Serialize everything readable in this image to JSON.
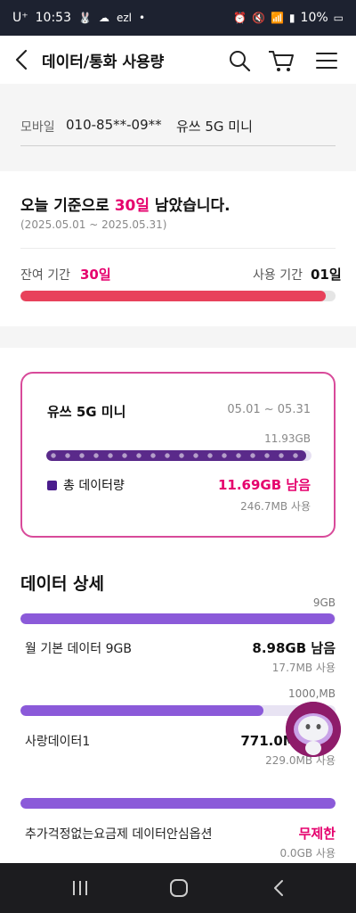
{
  "status_bar": {
    "carrier": "U⁺",
    "time": "10:53",
    "battery": "10%"
  },
  "app_bar": {
    "title": "데이터/통화 사용량",
    "icons": [
      "back-arrow-icon",
      "search-icon",
      "cart-icon",
      "menu-icon"
    ]
  },
  "line_info": {
    "label": "모바일",
    "number": "010-85**-09**",
    "plan": "유쓰 5G 미니"
  },
  "period_summary": {
    "headline_prefix": "오늘 기준으로 ",
    "headline_highlight": "30일",
    "headline_suffix": " 남았습니다.",
    "date_range": "(2025.05.01 ~ 2025.05.31)",
    "remaining_label": "잔여 기간",
    "remaining_value": "30일",
    "used_label": "사용 기간",
    "used_value": "01일",
    "progress_fraction": 0.968
  },
  "plan_card": {
    "plan_name": "유쓰 5G 미니",
    "period": "05.01 ~ 05.31",
    "capacity": "11.93GB",
    "total_label": "총 데이터량",
    "remaining": "11.69GB 남음",
    "used": "246.7MB 사용",
    "remaining_fraction": 0.98
  },
  "data_detail": {
    "title": "데이터 상세",
    "items": [
      {
        "capacity": "9GB",
        "name": "월 기본 데이터 9GB",
        "remaining": "8.98GB 남음",
        "used": "17.7MB 사용",
        "remaining_fraction": 0.998
      },
      {
        "capacity": "1000,MB",
        "name": "사랑데이터1",
        "remaining": "771.0MB 남음",
        "used": "229.0MB 사용",
        "remaining_fraction": 0.771
      },
      {
        "capacity": "",
        "name": "추가걱정없는요금제 데이터안심옵션",
        "remaining": "무제한",
        "used": "0.0GB 사용",
        "remaining_fraction": 1.0
      }
    ]
  },
  "colors": {
    "accent_pink": "#e5006d",
    "progress_red": "#e8415b",
    "card_border": "#d84a9a",
    "purple_dark": "#5a2a8a",
    "purple_light": "#8b5ad9"
  }
}
